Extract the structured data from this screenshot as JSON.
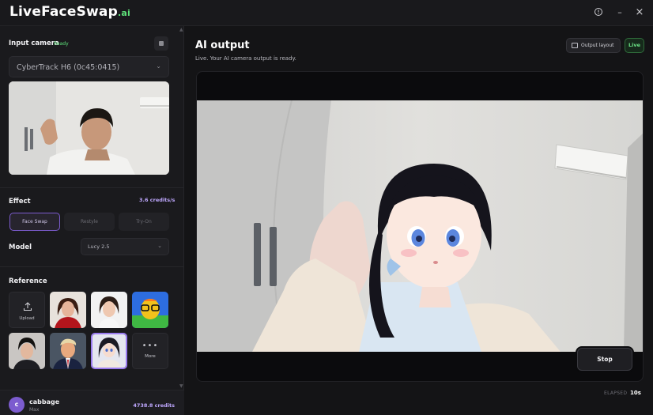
{
  "app": {
    "logo_main": "LiveFaceSwap",
    "logo_suffix": ".ai"
  },
  "window_controls": {
    "minimize": "–",
    "close": "×"
  },
  "sidebar": {
    "input_camera": {
      "title": "Input camera",
      "status": "Ready",
      "device": "CyberTrack H6 (0c45:0415)"
    },
    "effect": {
      "title": "Effect",
      "credits_rate": "3.6 credits/s",
      "options": [
        "Face Swap",
        "Restyle",
        "Try-On"
      ],
      "active": "Face Swap"
    },
    "model": {
      "title": "Model",
      "value": "Lucy 2.5"
    },
    "reference": {
      "title": "Reference",
      "upload_label": "Upload",
      "more_label": "More"
    },
    "user": {
      "initial": "c",
      "name": "cabbage",
      "plan": "Max",
      "credits": "4738.8 credits"
    }
  },
  "main": {
    "title": "AI output",
    "subtitle": "Live. Your AI camera output is ready.",
    "layout_button": "Output layout",
    "live_badge": "Live",
    "stop_button": "Stop",
    "elapsed_label": "ELAPSED",
    "elapsed_value": "10s"
  },
  "colors": {
    "accent_green": "#5ee27a",
    "accent_purple": "#7c5ccf",
    "credits_purple": "#bfa8ff"
  }
}
